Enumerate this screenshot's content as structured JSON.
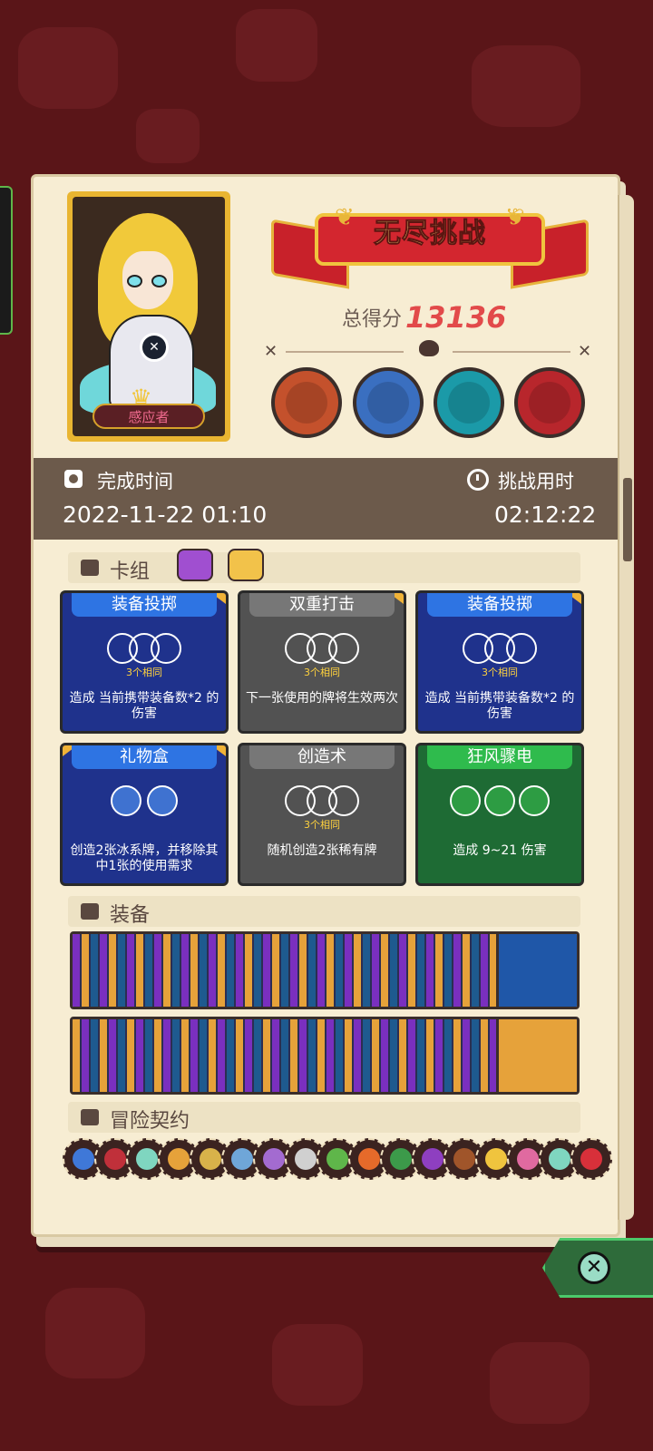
{
  "header": {
    "title": "无尽挑战",
    "score_label": "总得分",
    "score_value": "13136"
  },
  "hero": {
    "role": "感应者"
  },
  "bosses": [
    {
      "name": "boss-1",
      "color": "#c4512c"
    },
    {
      "name": "boss-2",
      "color": "#3a6fc0"
    },
    {
      "name": "boss-3",
      "color": "#1b9aa8"
    },
    {
      "name": "boss-4",
      "color": "#b8262c"
    }
  ],
  "info": {
    "finish_label": "完成时间",
    "finish_value": "2022-11-22 01:10",
    "duration_label": "挑战用时",
    "duration_value": "02:12:22"
  },
  "deck": {
    "label": "卡组",
    "cards": [
      {
        "title": "装备投掷",
        "same": "3个相同",
        "desc": "造成 当前携带装备数*2 的伤害"
      },
      {
        "title": "双重打击",
        "same": "3个相同",
        "desc": "下一张使用的牌将生效两次"
      },
      {
        "title": "装备投掷",
        "same": "3个相同",
        "desc": "造成 当前携带装备数*2 的伤害"
      },
      {
        "title": "礼物盒",
        "desc": "创造2张冰系牌，并移除其中1张的使用需求"
      },
      {
        "title": "创造术",
        "same": "3个相同",
        "desc": "随机创造2张稀有牌"
      },
      {
        "title": "狂风骤电",
        "desc": "造成 9~21 伤害"
      }
    ]
  },
  "equipment": {
    "label": "装备"
  },
  "contracts": {
    "label": "冒险契约"
  },
  "colors": {
    "accent": "#e24a4a",
    "band": "#6c5a4b",
    "panel": "#f7edd3"
  }
}
